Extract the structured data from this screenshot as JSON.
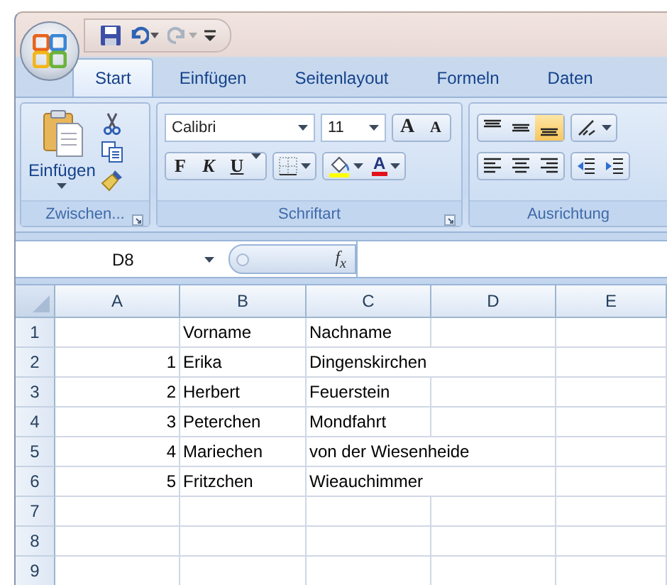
{
  "quick_access": [
    {
      "kind": "save",
      "disabled": false
    },
    {
      "kind": "undo",
      "disabled": false
    },
    {
      "kind": "redo",
      "disabled": true
    }
  ],
  "tabs": [
    {
      "label": "Start",
      "selected": true
    },
    {
      "label": "Einfügen",
      "selected": false
    },
    {
      "label": "Seitenlayout",
      "selected": false
    },
    {
      "label": "Formeln",
      "selected": false
    },
    {
      "label": "Daten",
      "selected": false
    }
  ],
  "ribbon": {
    "groups": [
      {
        "kind": "clipboard",
        "title": "Zwischen...",
        "paste_label": "Einfügen"
      },
      {
        "kind": "font",
        "title": "Schriftart",
        "font_name": "Calibri",
        "font_size": "11",
        "grow_label": "A",
        "shrink_label": "A",
        "bold_label": "F",
        "italic_label": "K",
        "underline_label": "U",
        "color_label": "A"
      },
      {
        "kind": "alignment",
        "title": "Ausrichtung",
        "vertical": [
          {
            "kind": "top",
            "selected": false
          },
          {
            "kind": "middle",
            "selected": false
          },
          {
            "kind": "bottom",
            "selected": true
          }
        ]
      }
    ]
  },
  "formula_bar": {
    "name_box": "D8",
    "function_label": "f$_{x}$"
  },
  "sheet": {
    "columns": [
      "A",
      "B",
      "C",
      "D",
      "E"
    ],
    "rows": [
      {
        "header": "1",
        "cells": [
          {
            "kind": "empty"
          },
          {
            "kind": "text",
            "text": "Vorname",
            "overflow": false
          },
          {
            "kind": "text",
            "text": "Nachname",
            "overflow": false
          }
        ]
      },
      {
        "header": "2",
        "cells": [
          {
            "kind": "number",
            "text": "1"
          },
          {
            "kind": "text",
            "text": "Erika",
            "overflow": false
          },
          {
            "kind": "text",
            "text": "Dingenskirchen",
            "overflow": true
          }
        ]
      },
      {
        "header": "3",
        "cells": [
          {
            "kind": "number",
            "text": "2"
          },
          {
            "kind": "text",
            "text": "Herbert",
            "overflow": false
          },
          {
            "kind": "text",
            "text": "Feuerstein",
            "overflow": false
          }
        ]
      },
      {
        "header": "4",
        "cells": [
          {
            "kind": "number",
            "text": "3"
          },
          {
            "kind": "text",
            "text": "Peterchen",
            "overflow": false
          },
          {
            "kind": "text",
            "text": "Mondfahrt",
            "overflow": false
          }
        ]
      },
      {
        "header": "5",
        "cells": [
          {
            "kind": "number",
            "text": "4"
          },
          {
            "kind": "text",
            "text": "Mariechen",
            "overflow": false
          },
          {
            "kind": "text",
            "text": "von der Wiesenheide",
            "overflow": true
          }
        ]
      },
      {
        "header": "6",
        "cells": [
          {
            "kind": "number",
            "text": "5"
          },
          {
            "kind": "text",
            "text": "Fritzchen",
            "overflow": false
          },
          {
            "kind": "text",
            "text": "Wieauchimmer",
            "overflow": true
          }
        ]
      },
      {
        "header": "7"
      },
      {
        "header": "8"
      },
      {
        "header": "9"
      }
    ]
  }
}
